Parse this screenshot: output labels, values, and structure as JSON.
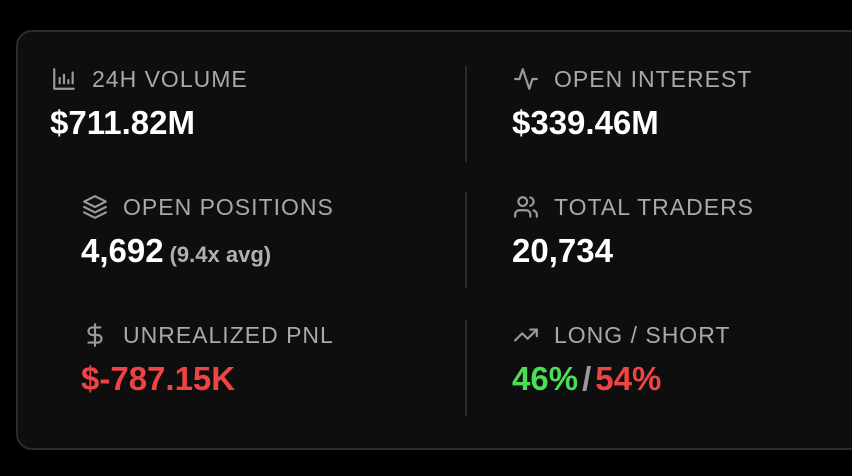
{
  "stats": {
    "volume": {
      "label": "24H VOLUME",
      "value": "$711.82M",
      "icon": "bar-chart-icon"
    },
    "open_interest": {
      "label": "OPEN INTEREST",
      "value": "$339.46M",
      "icon": "activity-icon"
    },
    "open_positions": {
      "label": "OPEN POSITIONS",
      "value": "4,692",
      "sub": "(9.4x avg)",
      "icon": "layers-icon"
    },
    "total_traders": {
      "label": "TOTAL TRADERS",
      "value": "20,734",
      "icon": "users-icon"
    },
    "unrealized_pnl": {
      "label": "UNREALIZED PNL",
      "value": "$-787.15K",
      "icon": "dollar-icon",
      "color": "#ef4444"
    },
    "long_short": {
      "label": "LONG / SHORT",
      "long": "46%",
      "separator": "/",
      "short": "54%",
      "icon": "trending-up-icon",
      "long_color": "#4ade56",
      "short_color": "#ef4444"
    }
  }
}
